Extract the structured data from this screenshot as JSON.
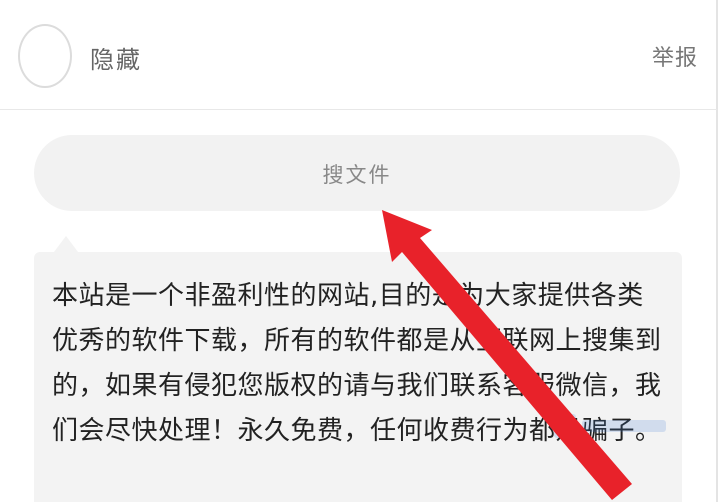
{
  "header": {
    "username": "隐藏",
    "report_label": "举报"
  },
  "search": {
    "label": "搜文件"
  },
  "notice": {
    "text": "本站是一个非盈利性的网站,目的是为大家提供各类优秀的软件下载，所有的软件都是从互联网上搜集到的，如果有侵犯您版权的请与我们联系客服微信，我们会尽快处理！永久免费，任何收费行为都是骗子。"
  },
  "colors": {
    "arrow": "#e8222a",
    "pill_bg": "#f2f2f2",
    "notice_bg": "#f3f3f3"
  },
  "icons": {
    "avatar": "user-avatar-placeholder",
    "arrow": "red-pointer-arrow"
  }
}
